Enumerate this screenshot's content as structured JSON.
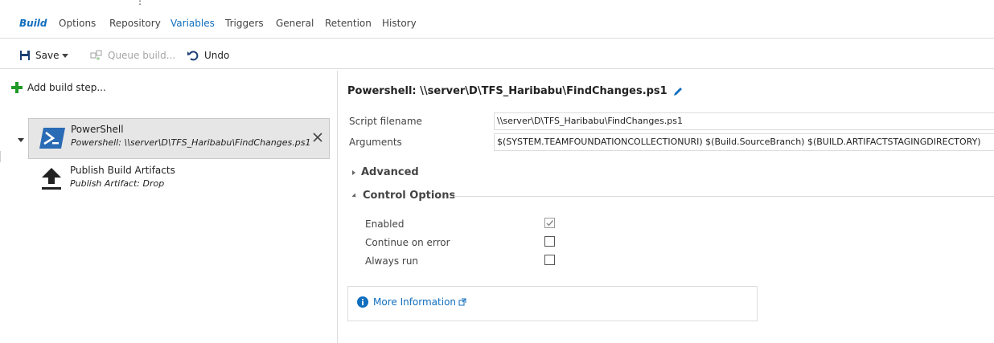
{
  "tabs": [
    {
      "label": "Build",
      "state": "active"
    },
    {
      "label": "Options"
    },
    {
      "label": "Repository"
    },
    {
      "label": "Variables",
      "state": "highlight"
    },
    {
      "label": "Triggers"
    },
    {
      "label": "General"
    },
    {
      "label": "Retention"
    },
    {
      "label": "History"
    }
  ],
  "toolbar": {
    "save_label": "Save",
    "queue_label": "Queue build...",
    "undo_label": "Undo"
  },
  "left": {
    "add_step_label": "Add build step...",
    "steps": [
      {
        "title": "PowerShell",
        "subtitle": "Powershell: \\\\server\\D\\TFS_Haribabu\\FindChanges.ps1",
        "icon": "powershell-icon"
      },
      {
        "title": "Publish Build Artifacts",
        "subtitle": "Publish Artifact: Drop",
        "icon": "upload-icon"
      }
    ]
  },
  "detail": {
    "title": "Powershell: \\\\server\\D\\TFS_Haribabu\\FindChanges.ps1",
    "fields": [
      {
        "label": "Script filename",
        "value": "\\\\server\\D\\TFS_Haribabu\\FindChanges.ps1"
      },
      {
        "label": "Arguments",
        "value": "$(SYSTEM.TEAMFOUNDATIONCOLLECTIONURI) $(Build.SourceBranch) $(BUILD.ARTIFACTSTAGINGDIRECTORY)"
      }
    ],
    "advanced_label": "Advanced",
    "control_options_label": "Control Options",
    "options": [
      {
        "label": "Enabled",
        "checked": true
      },
      {
        "label": "Continue on error",
        "checked": false
      },
      {
        "label": "Always run",
        "checked": false
      }
    ],
    "more_info_label": "More Information"
  },
  "colors": {
    "accent": "#106ebe",
    "add_green": "#1f9a26",
    "powershell_blue": "#2a6bb5"
  }
}
